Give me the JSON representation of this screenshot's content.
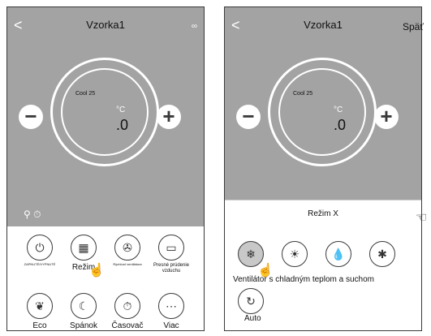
{
  "left_screen": {
    "title": "Vzorka1",
    "back_icon": "<",
    "more_icon": "∞",
    "mode_label": "Cool 25",
    "unit": "°C",
    "temp_value": ".0",
    "minus": "−",
    "plus": "+",
    "functions": [
      {
        "icon": "power-icon",
        "label": "ZAPNUTÉ/VYPNUTÉ"
      },
      {
        "icon": "mode-icon",
        "label": "Režim"
      },
      {
        "icon": "fan-speed-icon",
        "label": "Rýchlosť ventilátora"
      },
      {
        "icon": "airflow-icon",
        "label": "Presné prúdenie vzduchu"
      },
      {
        "icon": "eco-icon",
        "label": "Eco"
      },
      {
        "icon": "sleep-icon",
        "label": "Spánok"
      },
      {
        "icon": "timer-icon",
        "label": "Časovač"
      },
      {
        "icon": "more-icon",
        "label": "Viac"
      }
    ]
  },
  "right_screen": {
    "title": "Vzorka1",
    "back_icon": "<",
    "mode_label": "Cool 25",
    "unit": "°C",
    "temp_value": ".0",
    "minus": "−",
    "plus": "+",
    "mode_bar_label": "Režim X",
    "mode_options": [
      {
        "icon": "snowflake-icon",
        "label": "Ventilátor s chladným teplom a suchom",
        "active": true
      },
      {
        "icon": "sun-icon"
      },
      {
        "icon": "drop-icon"
      },
      {
        "icon": "fan-icon"
      },
      {
        "icon": "auto-icon",
        "label": "Auto"
      }
    ]
  },
  "spat_label": "Späť"
}
